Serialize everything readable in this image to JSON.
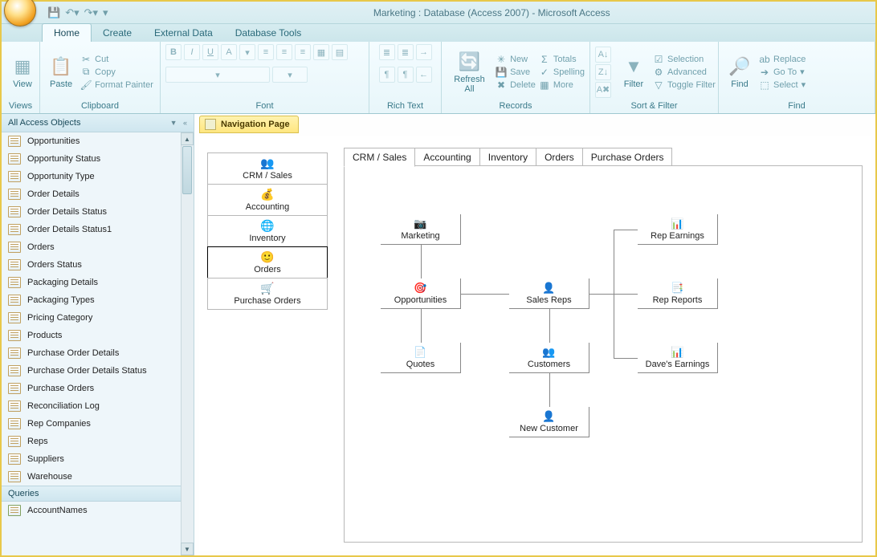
{
  "title": "Marketing : Database (Access 2007) - Microsoft Access",
  "tabs": {
    "t0": "Home",
    "t1": "Create",
    "t2": "External Data",
    "t3": "Database Tools"
  },
  "ribbon": {
    "views": "Views",
    "view": "View",
    "clipboard": "Clipboard",
    "paste": "Paste",
    "cut": "Cut",
    "copy": "Copy",
    "fmtpaint": "Format Painter",
    "font": "Font",
    "richtext": "Rich Text",
    "records": "Records",
    "refresh": "Refresh All",
    "new": "New",
    "save": "Save",
    "delete": "Delete",
    "totals": "Totals",
    "spelling": "Spelling",
    "more": "More",
    "sortfilter": "Sort & Filter",
    "filter": "Filter",
    "selection": "Selection",
    "advanced": "Advanced",
    "toggle": "Toggle Filter",
    "find_g": "Find",
    "find": "Find",
    "replace": "Replace",
    "goto": "Go To",
    "select": "Select"
  },
  "nav": {
    "header": "All Access Objects",
    "queries": "Queries",
    "items": [
      "Opportunities",
      "Opportunity Status",
      "Opportunity Type",
      "Order Details",
      "Order Details Status",
      "Order Details Status1",
      "Orders",
      "Orders Status",
      "Packaging Details",
      "Packaging Types",
      "Pricing Category",
      "Products",
      "Purchase Order Details",
      "Purchase Order Details Status",
      "Purchase Orders",
      "Reconciliation Log",
      "Rep Companies",
      "Reps",
      "Suppliers",
      "Warehouse"
    ],
    "q0": "AccountNames"
  },
  "doc": {
    "tab": "Navigation Page"
  },
  "cats": {
    "c0": "CRM / Sales",
    "c1": "Accounting",
    "c2": "Inventory",
    "c3": "Orders",
    "c4": "Purchase Orders"
  },
  "strip": {
    "s0": "CRM / Sales",
    "s1": "Accounting",
    "s2": "Inventory",
    "s3": "Orders",
    "s4": "Purchase Orders"
  },
  "nodes": {
    "marketing": "Marketing",
    "opportunities": "Opportunities",
    "quotes": "Quotes",
    "salesreps": "Sales Reps",
    "customers": "Customers",
    "newcustomer": "New Customer",
    "repearnings": "Rep Earnings",
    "repreports": "Rep Reports",
    "daves": "Dave's Earnings"
  }
}
